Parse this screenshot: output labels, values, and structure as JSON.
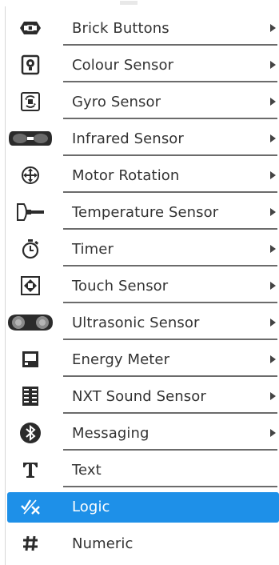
{
  "menu": {
    "items": [
      {
        "label": "Brick Buttons",
        "icon": "brick-buttons-icon",
        "has_submenu": true
      },
      {
        "label": "Colour Sensor",
        "icon": "colour-sensor-icon",
        "has_submenu": true
      },
      {
        "label": "Gyro Sensor",
        "icon": "gyro-sensor-icon",
        "has_submenu": true
      },
      {
        "label": "Infrared Sensor",
        "icon": "infrared-sensor-icon",
        "has_submenu": true
      },
      {
        "label": "Motor Rotation",
        "icon": "motor-rotation-icon",
        "has_submenu": true
      },
      {
        "label": "Temperature Sensor",
        "icon": "temperature-sensor-icon",
        "has_submenu": true
      },
      {
        "label": "Timer",
        "icon": "timer-icon",
        "has_submenu": true
      },
      {
        "label": "Touch Sensor",
        "icon": "touch-sensor-icon",
        "has_submenu": true
      },
      {
        "label": "Ultrasonic Sensor",
        "icon": "ultrasonic-sensor-icon",
        "has_submenu": true
      },
      {
        "label": "Energy Meter",
        "icon": "energy-meter-icon",
        "has_submenu": true
      },
      {
        "label": "NXT Sound Sensor",
        "icon": "nxt-sound-sensor-icon",
        "has_submenu": true
      },
      {
        "label": "Messaging",
        "icon": "messaging-icon",
        "has_submenu": true
      },
      {
        "label": "Text",
        "icon": "text-icon",
        "has_submenu": false
      },
      {
        "label": "Logic",
        "icon": "logic-icon",
        "has_submenu": false,
        "selected": true
      },
      {
        "label": "Numeric",
        "icon": "numeric-icon",
        "has_submenu": false
      }
    ],
    "colors": {
      "selection": "#1e90e8",
      "text": "#333333",
      "icon": "#2b2b2b"
    }
  }
}
